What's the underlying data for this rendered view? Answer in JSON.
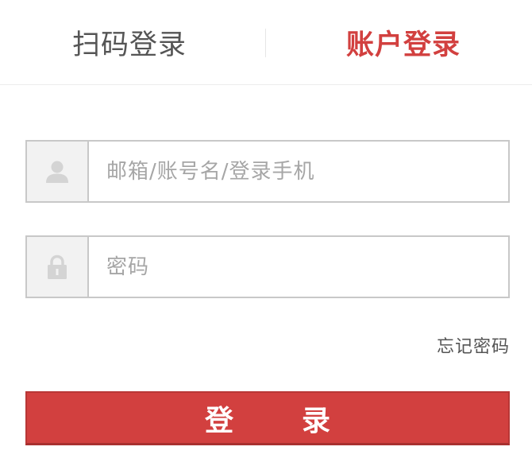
{
  "tabs": {
    "qr_login": "扫码登录",
    "account_login": "账户登录",
    "active": "account_login"
  },
  "username": {
    "icon": "user-icon",
    "value": "",
    "placeholder": "邮箱/账号名/登录手机"
  },
  "password": {
    "icon": "lock-icon",
    "value": "",
    "placeholder": "密码"
  },
  "forgot_password": "忘记密码",
  "login_button": "登录",
  "colors": {
    "accent": "#d2403f",
    "border": "#c8c8c8",
    "icon_bg": "#f2f2f2"
  }
}
